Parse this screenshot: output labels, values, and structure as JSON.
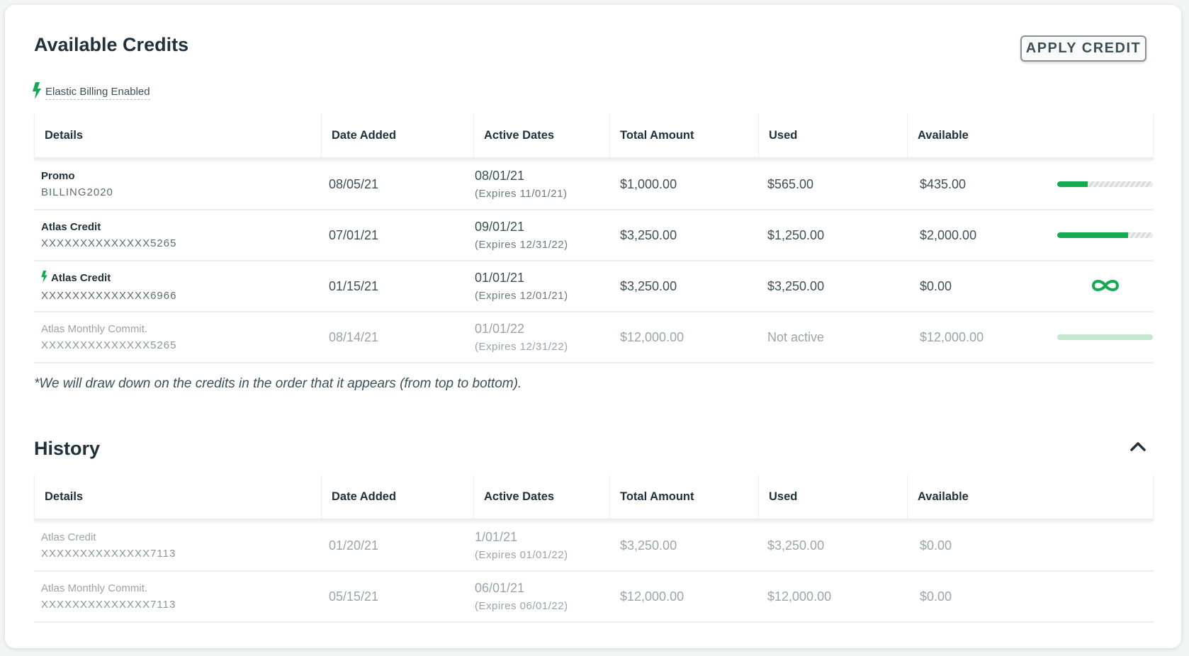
{
  "available_credits": {
    "title": "Available Credits",
    "apply_button": "APPLY CREDIT",
    "elastic_billing_label": "Elastic Billing Enabled",
    "columns": [
      "Details",
      "Date Added",
      "Active Dates",
      "Total Amount",
      "Used",
      "Available"
    ],
    "rows": [
      {
        "name": "Promo",
        "code": "BILLING2020",
        "elastic": false,
        "muted": false,
        "date_added": "08/05/21",
        "active_start": "08/01/21",
        "active_expires": "(Expires 11/01/21)",
        "total": "$1,000.00",
        "used": "$565.00",
        "available": "$435.00",
        "indicator": "bar",
        "bar_fill_fraction": 0.32
      },
      {
        "name": "Atlas Credit",
        "code": "XXXXXXXXXXXXXX5265",
        "elastic": false,
        "muted": false,
        "date_added": "07/01/21",
        "active_start": "09/01/21",
        "active_expires": "(Expires 12/31/22)",
        "total": "$3,250.00",
        "used": "$1,250.00",
        "available": "$2,000.00",
        "indicator": "bar",
        "bar_fill_fraction": 0.74
      },
      {
        "name": "Atlas Credit",
        "code": "XXXXXXXXXXXXXX6966",
        "elastic": true,
        "muted": false,
        "date_added": "01/15/21",
        "active_start": "01/01/21",
        "active_expires": "(Expires 12/01/21)",
        "total": "$3,250.00",
        "used": "$3,250.00",
        "available": "$0.00",
        "indicator": "infinity"
      },
      {
        "name": "Atlas Monthly Commit.",
        "code": "XXXXXXXXXXXXXX5265",
        "elastic": false,
        "muted": true,
        "date_added": "08/14/21",
        "active_start": "01/01/22",
        "active_expires": "(Expires 12/31/22)",
        "total": "$12,000.00",
        "used": "Not active",
        "available": "$12,000.00",
        "indicator": "pending-bar"
      }
    ],
    "note": "*We will draw down on the credits in the order that it appears (from top to bottom)."
  },
  "history": {
    "title": "History",
    "collapse_icon": "chevron-up-icon",
    "columns": [
      "Details",
      "Date Added",
      "Active Dates",
      "Total Amount",
      "Used",
      "Available"
    ],
    "rows": [
      {
        "name": "Atlas Credit",
        "code": "XXXXXXXXXXXXXX7113",
        "date_added": "01/20/21",
        "active_start": "1/01/21",
        "active_expires": "(Expires 01/01/22)",
        "total": "$3,250.00",
        "used": "$3,250.00",
        "available": "$0.00"
      },
      {
        "name": "Atlas Monthly Commit.",
        "code": "XXXXXXXXXXXXXX7113",
        "date_added": "05/15/21",
        "active_start": "06/01/21",
        "active_expires": "(Expires 06/01/22)",
        "total": "$12,000.00",
        "used": "$12,000.00",
        "available": "$0.00"
      }
    ]
  },
  "colors": {
    "accent_green": "#13aa52",
    "pending_green": "#c3e7cf",
    "text_dark": "#21313c",
    "text_muted": "#9aa5ab"
  },
  "icons": {
    "elastic": "lightning-bolt-icon",
    "unlimited": "infinity-icon",
    "collapse": "chevron-up-icon"
  }
}
